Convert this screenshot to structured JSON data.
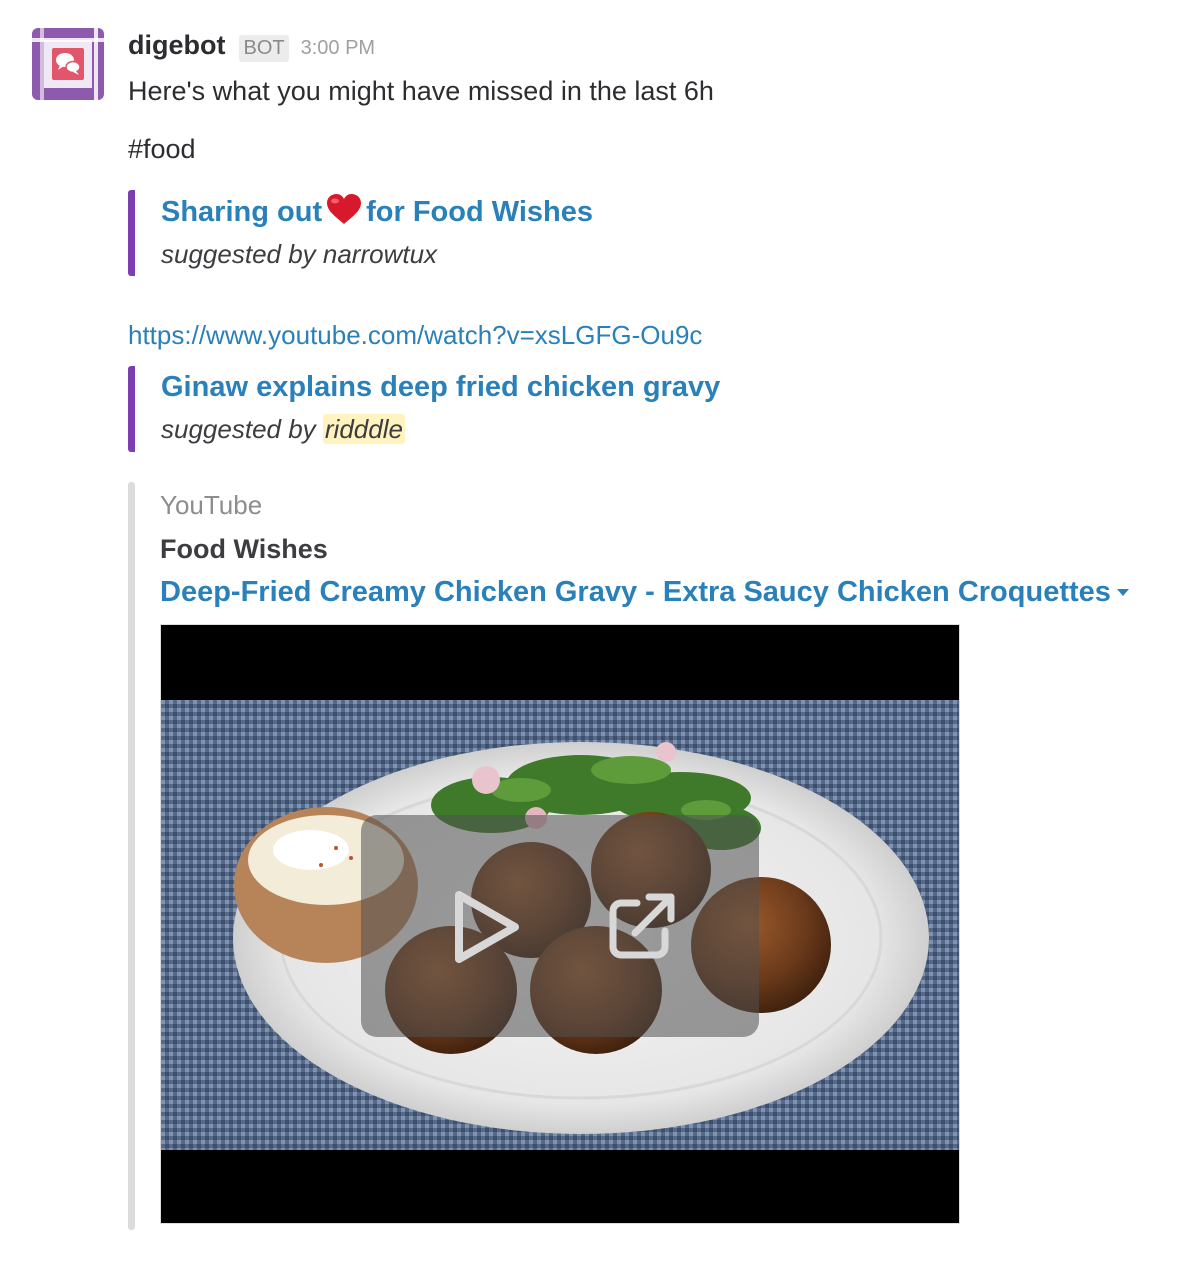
{
  "message": {
    "bot_name": "digebot",
    "bot_badge": "BOT",
    "timestamp": "3:00 PM",
    "intro": "Here's what you might have missed in the last 6h",
    "channel": "#food"
  },
  "items": [
    {
      "title_before": "Sharing out",
      "title_emoji": "red-heart",
      "title_after": "for Food Wishes",
      "suggested_prefix": "suggested by ",
      "suggested_user": "narrowtux"
    },
    {
      "url": "https://www.youtube.com/watch?v=xsLGFG-Ou9c",
      "title": "Ginaw explains deep fried chicken gravy",
      "suggested_prefix": "suggested by ",
      "suggested_user": "ridddle"
    }
  ],
  "attachment": {
    "service": "YouTube",
    "author": "Food Wishes",
    "video_title": "Deep-Fried Creamy Chicken Gravy - Extra Saucy Chicken Croquettes"
  },
  "colors": {
    "link": "#2a80b9",
    "quote_bar": "#7c3fb1",
    "attachment_bar": "#dcdcdc",
    "mention_highlight": "#fff3c0",
    "avatar": "#8e5aae"
  },
  "icons": [
    "chat-bubble-icon",
    "heart-emoji-icon",
    "caret-down-icon",
    "play-icon",
    "external-link-icon"
  ]
}
